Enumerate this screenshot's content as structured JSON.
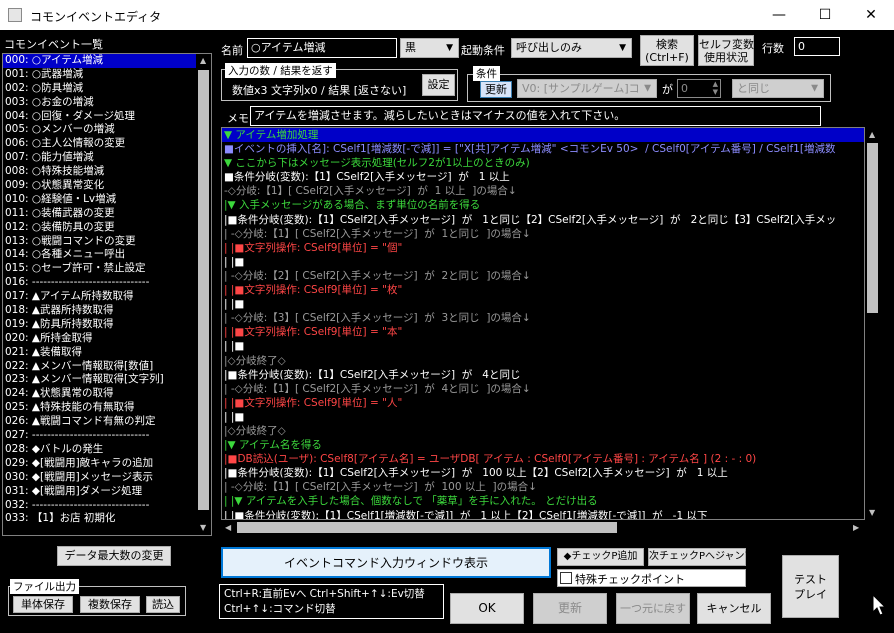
{
  "window": {
    "title": "コモンイベントエディタ",
    "controls": {
      "minimize": "—",
      "maximize": "☐",
      "close": "✕"
    }
  },
  "sidebar": {
    "header": "コモンイベント一覧",
    "items": [
      "000: ○アイテム増減",
      "001: ○武器増減",
      "002: ○防具増減",
      "003: ○お金の増減",
      "004: ○回復・ダメージ処理",
      "005: ○メンバーの増減",
      "006: ○主人公情報の変更",
      "007: ○能力値増減",
      "008: ○特殊技能増減",
      "009: ○状態異常変化",
      "010: ○経験値・Lv増減",
      "011: ○装備武器の変更",
      "012: ○装備防具の変更",
      "013: ○戦闘コマンドの変更",
      "014: ○各種メニュー呼出",
      "015: ○セーブ許可・禁止設定",
      "016: -------------------------------",
      "017: ▲アイテム所持数取得",
      "018: ▲武器所持数取得",
      "019: ▲防具所持数取得",
      "020: ▲所持金取得",
      "021: ▲装備取得",
      "022: ▲メンバー情報取得[数値]",
      "023: ▲メンバー情報取得[文字列]",
      "024: ▲状態異常の取得",
      "025: ▲特殊技能の有無取得",
      "026: ▲戦闘コマンド有無の判定",
      "027: -------------------------------",
      "028: ◆バトルの発生",
      "029: ◆[戦闘用]敵キャラの追加",
      "030: ◆[戦闘用]メッセージ表示",
      "031: ◆[戦闘用]ダメージ処理",
      "032: -------------------------------",
      "033: 【1】お店 初期化"
    ],
    "selected_index": 0,
    "max_data_button": "データ最大数の変更",
    "file_output": {
      "title": "ファイル出力",
      "single_save": "単体保存",
      "multi_save": "複数保存",
      "load": "読込"
    }
  },
  "header": {
    "name_label": "名前",
    "name_value": "○アイテム増減",
    "color_value": "黒",
    "trigger_label": "起動条件",
    "trigger_value": "呼び出しのみ",
    "search_button": "検索\n(Ctrl+F)",
    "self_var_button": "セルフ変数\n使用状況",
    "line_count_label": "行数",
    "line_count_value": "0",
    "io_group_title": "入力の数 / 結果を返す",
    "io_summary": "数値x3 文字列x0 / 結果 [返さない]",
    "settings_button": "設定",
    "condition_group_title": "条件",
    "update_button": "更新",
    "condition_var": "V0: [サンプルゲーム]コ",
    "ga_label": "が",
    "condition_number": "0",
    "condition_op": "と同じ",
    "memo_label": "メモ",
    "memo_value": "アイテムを増減させます。減らしたいときはマイナスの値を入れて下さい。"
  },
  "event_lines": [
    {
      "text": "▼ アイテム増加処理",
      "color": "#3cd83c"
    },
    {
      "text": "■イベントの挿入[名]: CSelf1[増減数[-で減]] = [\"X[共]アイテム増減\" <コモンEv 50>  / CSelf0[アイテム番号] / CSelf1[増減数",
      "color": "#8c8cff"
    },
    {
      "text": "▼ ここから下はメッセージ表示処理(セルフ2が1以上のときのみ)",
      "color": "#3cd83c"
    },
    {
      "text": "■条件分岐(変数):【1】CSelf2[入手メッセージ]  が   1 以上",
      "color": "#ffffff"
    },
    {
      "text": "-◇分岐:【1】[ CSelf2[入手メッセージ]  が  1 以上  ]の場合↓",
      "color": "#9a9a9a"
    },
    {
      "text": "|▼ 入手メッセージがある場合、まず単位の名前を得る",
      "color": "#3cd83c"
    },
    {
      "text": "|■条件分岐(変数):【1】CSelf2[入手メッセージ]  が   1と同じ【2】CSelf2[入手メッセージ]  が   2と同じ【3】CSelf2[入手メッ",
      "color": "#ffffff"
    },
    {
      "text": "| -◇分岐:【1】[ CSelf2[入手メッセージ]  が  1と同じ  ]の場合↓",
      "color": "#9a9a9a"
    },
    {
      "text": "| |■文字列操作: CSelf9[単位] = \"個\"",
      "color": "#ff4646"
    },
    {
      "text": "| |■",
      "color": "#ffffff"
    },
    {
      "text": "| -◇分岐:【2】[ CSelf2[入手メッセージ]  が  2と同じ  ]の場合↓",
      "color": "#9a9a9a"
    },
    {
      "text": "| |■文字列操作: CSelf9[単位] = \"枚\"",
      "color": "#ff4646"
    },
    {
      "text": "| |■",
      "color": "#ffffff"
    },
    {
      "text": "| -◇分岐:【3】[ CSelf2[入手メッセージ]  が  3と同じ  ]の場合↓",
      "color": "#9a9a9a"
    },
    {
      "text": "| |■文字列操作: CSelf9[単位] = \"本\"",
      "color": "#ff4646"
    },
    {
      "text": "| |■",
      "color": "#ffffff"
    },
    {
      "text": "|◇分岐終了◇",
      "color": "#9a9a9a"
    },
    {
      "text": "|■条件分岐(変数):【1】CSelf2[入手メッセージ]  が   4と同じ",
      "color": "#ffffff"
    },
    {
      "text": "| -◇分岐:【1】[ CSelf2[入手メッセージ]  が  4と同じ  ]の場合↓",
      "color": "#9a9a9a"
    },
    {
      "text": "| |■文字列操作: CSelf9[単位] = \"人\"",
      "color": "#ff4646"
    },
    {
      "text": "| |■",
      "color": "#ffffff"
    },
    {
      "text": "|◇分岐終了◇",
      "color": "#9a9a9a"
    },
    {
      "text": "|▼ アイテム名を得る",
      "color": "#3cd83c"
    },
    {
      "text": "|■DB読込(ユーザ): CSelf8[アイテム名] = ユーザDB[ アイテム : CSelf0[アイテム番号] : アイテム名 ] (2 : - : 0)",
      "color": "#ff4646"
    },
    {
      "text": "|■条件分岐(変数):【1】CSelf2[入手メッセージ]  が   100 以上【2】CSelf2[入手メッセージ]  が   1 以上",
      "color": "#ffffff"
    },
    {
      "text": "| -◇分岐:【1】[ CSelf2[入手メッセージ]  が  100 以上  ]の場合↓",
      "color": "#9a9a9a"
    },
    {
      "text": "| |▼ アイテムを入手した場合、個数なしで 「薬草」を手に入れた。 とだけ出る",
      "color": "#3cd83c"
    },
    {
      "text": "| |■条件分岐(変数):【1】CSelf1[増減数[-で減]]  が   1 以上【2】CSelf1[増減数[-で減]]  が   -1 以下",
      "color": "#ffffff"
    }
  ],
  "bottom": {
    "command_window_button": "イベントコマンド入力ウィンドウ表示",
    "checkpoint_add_button": "◆チェックP追加",
    "next_checkpoint_button": "次チェックPへジャンプ",
    "special_checkpoint_label": "特殊チェックポイント",
    "test_play_button": "テスト\nプレイ",
    "hint_line1": "Ctrl+R:直前Evへ   Ctrl+Shift+↑↓:Ev切替",
    "hint_line2": "Ctrl+↑↓:コマンド切替",
    "ok_button": "OK",
    "update_button": "更新",
    "undo_button": "一つ元に戻す",
    "cancel_button": "キャンセル"
  }
}
